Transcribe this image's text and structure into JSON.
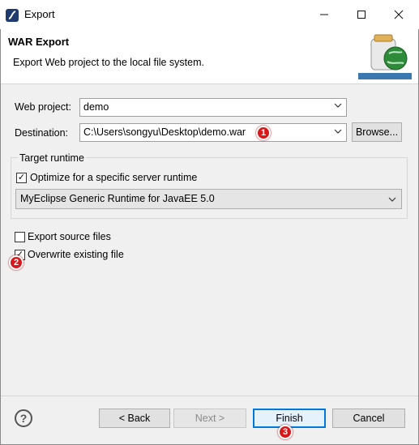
{
  "window": {
    "title": "Export"
  },
  "banner": {
    "title": "WAR Export",
    "description": "Export Web project to the local file system."
  },
  "form": {
    "web_project_label": "Web project:",
    "web_project_value": "demo",
    "destination_label": "Destination:",
    "destination_value": "C:\\Users\\songyu\\Desktop\\demo.war",
    "browse_label": "Browse...",
    "target_runtime_label": "Target runtime",
    "optimize_label": "Optimize for a specific server runtime",
    "optimize_checked": true,
    "runtime_value": "MyEclipse Generic Runtime for JavaEE 5.0",
    "export_source_label": "Export source files",
    "export_source_checked": false,
    "overwrite_label": "Overwrite existing file",
    "overwrite_checked": true
  },
  "buttons": {
    "back": "< Back",
    "next": "Next >",
    "finish": "Finish",
    "cancel": "Cancel"
  },
  "annotations": {
    "badge1": "1",
    "badge2": "2",
    "badge3": "3",
    "color": "#d8191b"
  }
}
